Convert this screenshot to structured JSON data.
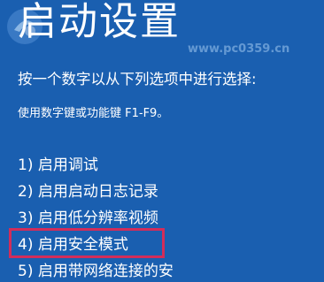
{
  "screen": {
    "title": "启动设置",
    "prompt": "按一个数字以从下列选项中进行选择:",
    "hint": "使用数字键或功能键 F1-F9。",
    "options": [
      {
        "label": "1) 启用调试"
      },
      {
        "label": "2) 启用启动日志记录"
      },
      {
        "label": "3) 启用低分辨率视频"
      },
      {
        "label": "4) 启用安全模式"
      },
      {
        "label": "5) 启用带网络连接的安"
      }
    ],
    "highlighted_option": "4) 启用安全模式"
  },
  "watermark": {
    "url": "www.pc0359.cn",
    "logo_icon": "watermark-logo-icon"
  },
  "colors": {
    "background": "#1a5fb0",
    "text": "#ffffff",
    "highlight_border": "#d22d5a"
  }
}
